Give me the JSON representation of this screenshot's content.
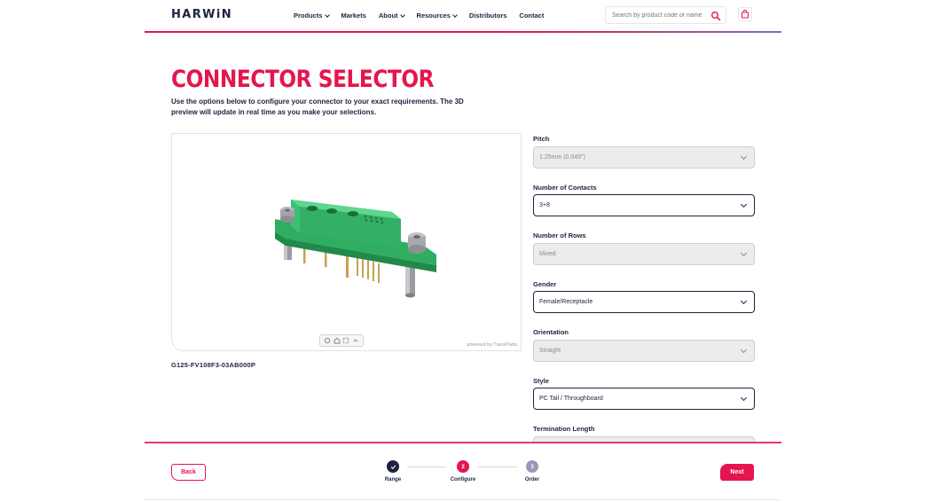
{
  "brand": {
    "logo": "HARWiN",
    "accent": "#e5154f",
    "navy": "#1d2340"
  },
  "nav": {
    "items": [
      {
        "label": "Products",
        "has_dropdown": true
      },
      {
        "label": "Markets",
        "has_dropdown": false
      },
      {
        "label": "About",
        "has_dropdown": true
      },
      {
        "label": "Resources",
        "has_dropdown": true
      },
      {
        "label": "Distributors",
        "has_dropdown": false
      },
      {
        "label": "Contact",
        "has_dropdown": false
      }
    ],
    "search_placeholder": "Search by product code or name",
    "search_icon": "search-icon",
    "cart_icon": "shopping-bag-icon"
  },
  "page": {
    "title": "CONNECTOR SELECTOR",
    "intro": "Use the options below to configure your connector to your exact requirements. The 3D preview will update in real time as you make your selections."
  },
  "viewer": {
    "powered_by": "powered by TraceParts",
    "tools": [
      "rotate-icon",
      "home-icon",
      "fit-icon",
      "expand-icon"
    ],
    "part_code": "G125-FV108F3-03AB000P"
  },
  "options": [
    {
      "label": "Pitch",
      "value": "1.25mm (0.049\")",
      "enabled": false
    },
    {
      "label": "Number of Contacts",
      "value": "3+8",
      "enabled": true
    },
    {
      "label": "Number of Rows",
      "value": "Mixed",
      "enabled": false
    },
    {
      "label": "Gender",
      "value": "Female/Receptacle",
      "enabled": true
    },
    {
      "label": "Orientation",
      "value": "Straight",
      "enabled": false
    },
    {
      "label": "Style",
      "value": "PC Tail / Throughboard",
      "enabled": true
    },
    {
      "label": "Termination Length",
      "value": "",
      "enabled": false
    }
  ],
  "footer": {
    "back_label": "Back",
    "next_label": "Next",
    "steps": [
      {
        "label": "Range",
        "number": "",
        "state": "done",
        "color": "#1d2340"
      },
      {
        "label": "Configure",
        "number": "2",
        "state": "current",
        "color": "#e5154f"
      },
      {
        "label": "Order",
        "number": "3",
        "state": "upcoming",
        "color": "#9a98b8"
      }
    ]
  }
}
